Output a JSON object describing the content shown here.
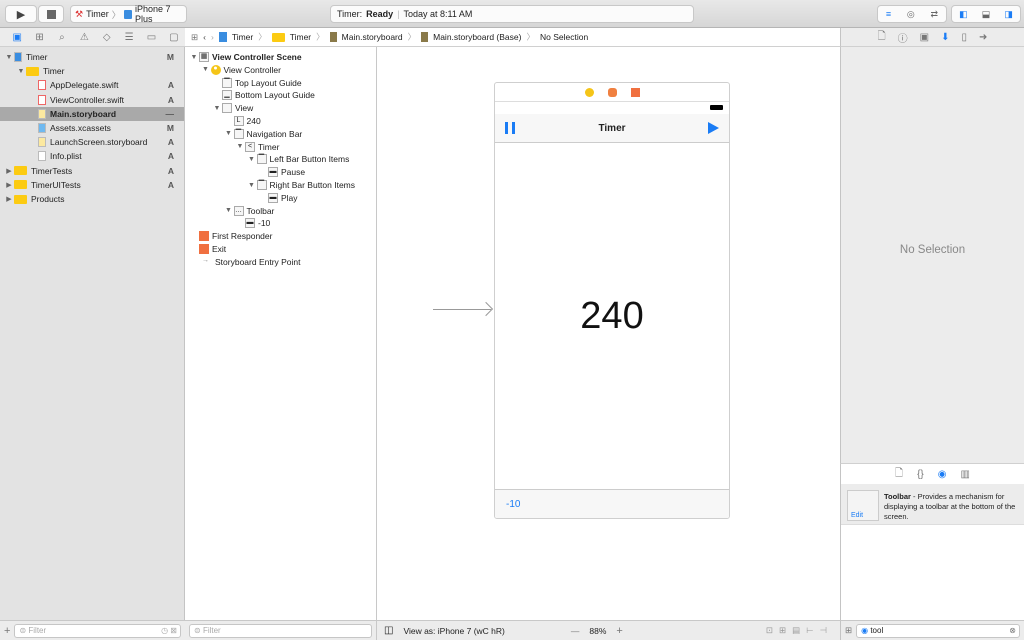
{
  "toolbar": {
    "scheme": "Timer",
    "device": "iPhone 7 Plus",
    "status_app": "Timer:",
    "status_state": "Ready",
    "status_time": "Today at 8:11 AM"
  },
  "navigator": {
    "items": [
      {
        "label": "Timer",
        "badge": "M",
        "type": "project",
        "depth": 0,
        "open": true
      },
      {
        "label": "Timer",
        "badge": "",
        "type": "folder",
        "depth": 1,
        "open": true
      },
      {
        "label": "AppDelegate.swift",
        "badge": "A",
        "type": "swift",
        "depth": 2
      },
      {
        "label": "ViewController.swift",
        "badge": "A",
        "type": "swift",
        "depth": 2
      },
      {
        "label": "Main.storyboard",
        "badge": "—",
        "type": "storyboard",
        "depth": 2,
        "selected": true
      },
      {
        "label": "Assets.xcassets",
        "badge": "M",
        "type": "assets",
        "depth": 2
      },
      {
        "label": "LaunchScreen.storyboard",
        "badge": "A",
        "type": "storyboard",
        "depth": 2
      },
      {
        "label": "Info.plist",
        "badge": "A",
        "type": "plist",
        "depth": 2
      },
      {
        "label": "TimerTests",
        "badge": "A",
        "type": "folder",
        "depth": 0,
        "closed": true
      },
      {
        "label": "TimerUITests",
        "badge": "A",
        "type": "folder",
        "depth": 0,
        "closed": true
      },
      {
        "label": "Products",
        "badge": "",
        "type": "folder",
        "depth": 0,
        "closed": true
      }
    ],
    "filter_placeholder": "Filter"
  },
  "jumpbar": {
    "crumbs": [
      "Timer",
      "Timer",
      "Main.storyboard",
      "Main.storyboard (Base)",
      "No Selection"
    ]
  },
  "outline": {
    "items": [
      {
        "label": "View Controller Scene",
        "depth": 0,
        "tri": "▼",
        "bold": true,
        "icon": "▦"
      },
      {
        "label": "View Controller",
        "depth": 1,
        "tri": "▼",
        "icon": "●"
      },
      {
        "label": "Top Layout Guide",
        "depth": 2,
        "icon": "▔"
      },
      {
        "label": "Bottom Layout Guide",
        "depth": 2,
        "icon": "▁"
      },
      {
        "label": "View",
        "depth": 2,
        "tri": "▼",
        "icon": ""
      },
      {
        "label": "240",
        "depth": 3,
        "icon": "L"
      },
      {
        "label": "Navigation Bar",
        "depth": 3,
        "tri": "▼",
        "icon": "▔"
      },
      {
        "label": "Timer",
        "depth": 4,
        "tri": "▼",
        "icon": "<"
      },
      {
        "label": "Left Bar Button Items",
        "depth": 5,
        "tri": "▼",
        "icon": "▔"
      },
      {
        "label": "Pause",
        "depth": 6,
        "icon": "▬"
      },
      {
        "label": "Right Bar Button Items",
        "depth": 5,
        "tri": "▼",
        "icon": "▔"
      },
      {
        "label": "Play",
        "depth": 6,
        "icon": "▬"
      },
      {
        "label": "Toolbar",
        "depth": 3,
        "tri": "▼",
        "icon": "…"
      },
      {
        "label": "-10",
        "depth": 4,
        "icon": "▬"
      },
      {
        "label": "First Responder",
        "depth": 0,
        "icon": "■"
      },
      {
        "label": "Exit",
        "depth": 0,
        "icon": "■"
      },
      {
        "label": "Storyboard Entry Point",
        "depth": 0,
        "icon": "→"
      }
    ],
    "filter_placeholder": "Filter"
  },
  "canvas": {
    "nav_title": "Timer",
    "label_value": "240",
    "toolbar_item": "-10",
    "view_as": "View as: iPhone 7 (wC hR)",
    "zoom": "88%"
  },
  "inspector": {
    "empty": "No Selection"
  },
  "library": {
    "item_title": "Toolbar",
    "item_desc": " - Provides a mechanism for displaying a toolbar at the bottom of the screen.",
    "edit": "Edit",
    "search_value": "tool"
  },
  "colors": {
    "accent": "#1a7cf5",
    "selection": "#a9a9a9"
  }
}
